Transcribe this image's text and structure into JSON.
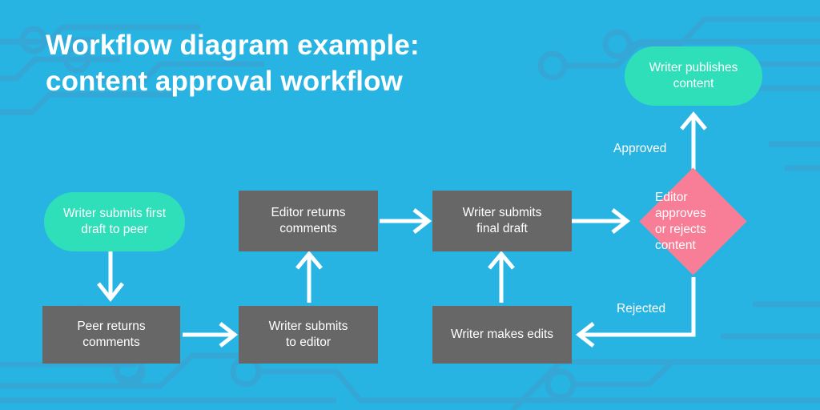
{
  "page": {
    "background_color": "#27b4e2",
    "title": "Workflow diagram example:\ncontent approval workflow"
  },
  "palette": {
    "background_blue": "#27b4e2",
    "circuit_line": "#35a7d6",
    "terminator_green": "#2fdfba",
    "process_gray": "#676767",
    "decision_pink": "#f87d96",
    "arrow_white": "#ffffff",
    "text_white": "#ffffff"
  },
  "diagram": {
    "nodes": [
      {
        "id": "writer-submits-first-draft",
        "label": "Writer submits first\ndraft to peer",
        "shape": "pill",
        "color": "#2fdfba"
      },
      {
        "id": "peer-returns-comments",
        "label": "Peer returns\ncomments",
        "shape": "rectangle",
        "color": "#676767"
      },
      {
        "id": "writer-submits-to-editor",
        "label": "Writer submits\nto editor",
        "shape": "rectangle",
        "color": "#676767"
      },
      {
        "id": "editor-returns-comments",
        "label": "Editor returns\ncomments",
        "shape": "rectangle",
        "color": "#676767"
      },
      {
        "id": "writer-submits-final-draft",
        "label": "Writer submits\nfinal draft",
        "shape": "rectangle",
        "color": "#676767"
      },
      {
        "id": "editor-approves-or-rejects",
        "label": "Editor approves\nor rejects content",
        "shape": "diamond",
        "color": "#f87d96"
      },
      {
        "id": "writer-makes-edits",
        "label": "Writer makes edits",
        "shape": "rectangle",
        "color": "#676767"
      },
      {
        "id": "writer-publishes-content",
        "label": "Writer publishes\ncontent",
        "shape": "pill",
        "color": "#2fdfba"
      }
    ],
    "edges": [
      {
        "from": "writer-submits-first-draft",
        "to": "peer-returns-comments",
        "label": ""
      },
      {
        "from": "peer-returns-comments",
        "to": "writer-submits-to-editor",
        "label": ""
      },
      {
        "from": "writer-submits-to-editor",
        "to": "editor-returns-comments",
        "label": ""
      },
      {
        "from": "editor-returns-comments",
        "to": "writer-submits-final-draft",
        "label": ""
      },
      {
        "from": "writer-submits-final-draft",
        "to": "editor-approves-or-rejects",
        "label": ""
      },
      {
        "from": "editor-approves-or-rejects",
        "to": "writer-publishes-content",
        "label": "Approved"
      },
      {
        "from": "editor-approves-or-rejects",
        "to": "writer-makes-edits",
        "label": "Rejected"
      },
      {
        "from": "writer-makes-edits",
        "to": "writer-submits-final-draft",
        "label": ""
      }
    ],
    "edge_labels": {
      "approved": "Approved",
      "rejected": "Rejected"
    }
  }
}
